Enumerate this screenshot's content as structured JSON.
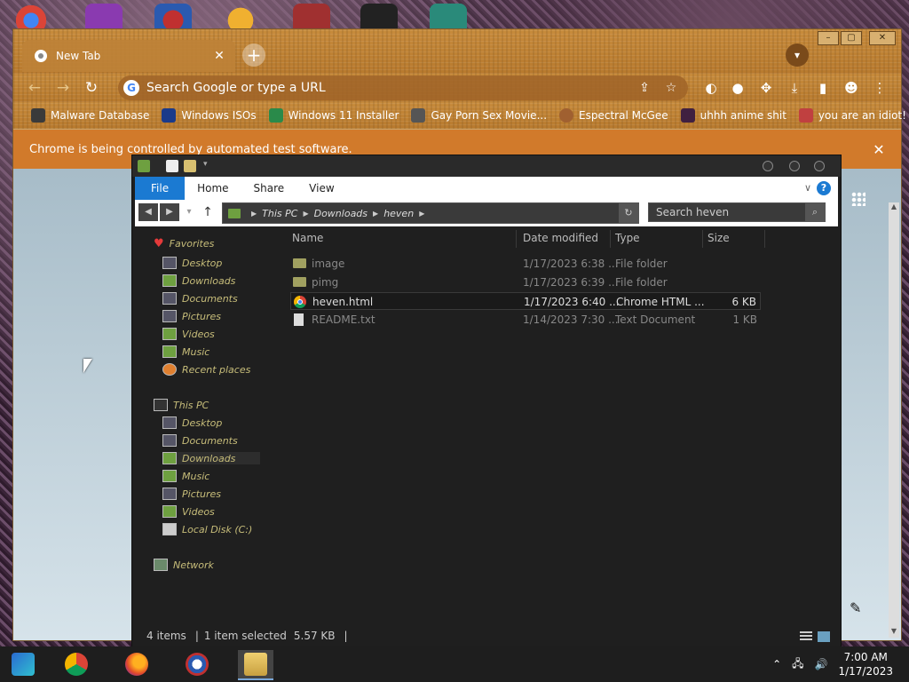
{
  "browser": {
    "tab_title": "New Tab",
    "tab_close": "✕",
    "new_tab": "+",
    "omnibox_placeholder": "Search Google or type a URL",
    "bookmarks": [
      {
        "label": "Malware Database",
        "color": "#3a3a3a"
      },
      {
        "label": "Windows ISOs",
        "color": "#1a3a8a"
      },
      {
        "label": "Windows 11 Installer",
        "color": "#2a8a4a"
      },
      {
        "label": "Gay Porn Sex Movie...",
        "color": "#555555"
      },
      {
        "label": "Espectral McGee",
        "color": "#a06030"
      },
      {
        "label": "uhhh anime shit",
        "color": "#402040"
      },
      {
        "label": "you are an idiot!",
        "color": "#c04040"
      }
    ],
    "infobar_message": "Chrome is being controlled by automated test software.",
    "infobar_close": "✕"
  },
  "explorer": {
    "ribbon_tabs": [
      "File",
      "Home",
      "Share",
      "View"
    ],
    "address": [
      "This PC",
      "Downloads",
      "heven"
    ],
    "search_placeholder": "Search heven",
    "nav": {
      "favorites": "Favorites",
      "favorites_items": [
        "Desktop",
        "Downloads",
        "Documents",
        "Pictures",
        "Videos",
        "Music",
        "Recent places"
      ],
      "this_pc": "This PC",
      "this_pc_items": [
        "Desktop",
        "Documents",
        "Downloads",
        "Music",
        "Pictures",
        "Videos",
        "Local Disk (C:)"
      ],
      "network": "Network"
    },
    "columns": [
      "Name",
      "Date modified",
      "Type",
      "Size"
    ],
    "files": [
      {
        "name": "image",
        "date": "1/17/2023 6:38 ...",
        "type": "File folder",
        "size": "",
        "icon": "folder-icon"
      },
      {
        "name": "pimg",
        "date": "1/17/2023 6:39 ...",
        "type": "File folder",
        "size": "",
        "icon": "folder-icon"
      },
      {
        "name": "heven.html",
        "date": "1/17/2023 6:40 ...",
        "type": "Chrome HTML ...",
        "size": "6 KB",
        "icon": "chrome-icon"
      },
      {
        "name": "README.txt",
        "date": "1/14/2023 7:30 ...",
        "type": "Text Document",
        "size": "1 KB",
        "icon": "text-file-icon"
      }
    ],
    "status": {
      "items": "4 items",
      "selected": "1 item selected",
      "size": "5.57 KB",
      "separator": "|"
    }
  },
  "taskbar": {
    "time": "7:00 AM",
    "date": "1/17/2023"
  },
  "colors": {
    "ribbon_file": "#1b7ad2",
    "infobar": "#d27828",
    "explorer_bg": "#1f1f1f"
  }
}
